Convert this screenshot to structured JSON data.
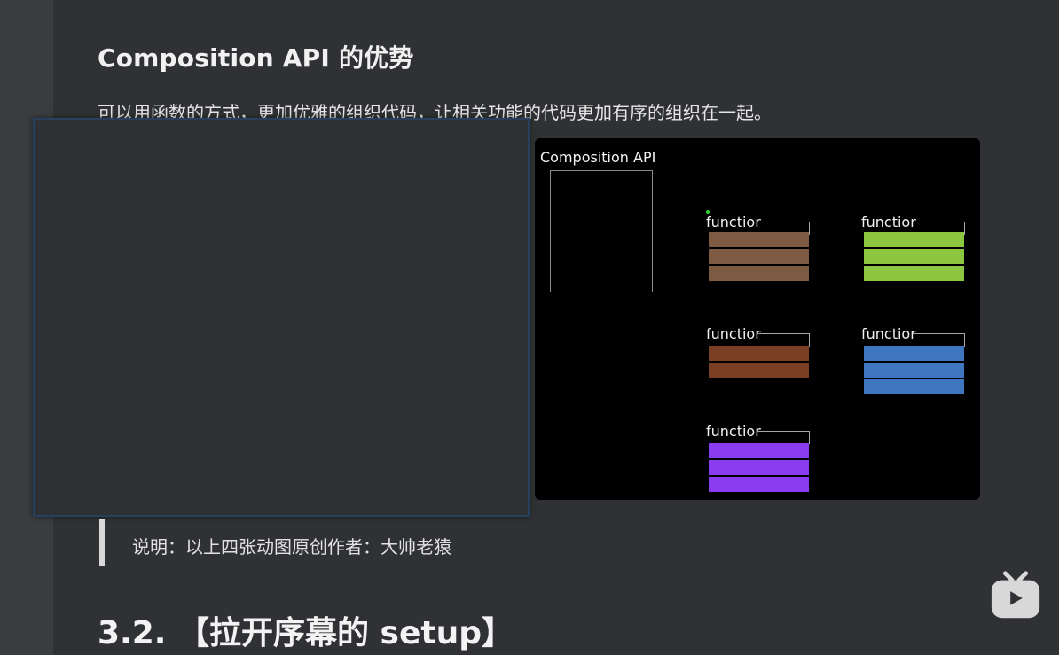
{
  "document": {
    "heading": "Composition API 的优势",
    "paragraph": "可以用函数的方式，更加优雅的组织代码，让相关功能的代码更加有序的组织在一起。",
    "quote": "说明：以上四张动图原创作者：大帅老猿",
    "section_heading": "3.2. 【拉开序幕的 setup】"
  },
  "diagram": {
    "title": "Composition API",
    "functions": [
      {
        "label": "functior",
        "color": "#7d5a42",
        "bars": 3
      },
      {
        "label": "functior",
        "color": "#8dc640",
        "bars": 3
      },
      {
        "label": "functior",
        "color": "#7a3f22",
        "bars": 2
      },
      {
        "label": "functior",
        "color": "#3f76c0",
        "bars": 3
      },
      {
        "label": "functior",
        "color": "#8a3df0",
        "bars": 3
      }
    ]
  },
  "icons": {
    "player": "bilibili-tv-icon"
  }
}
